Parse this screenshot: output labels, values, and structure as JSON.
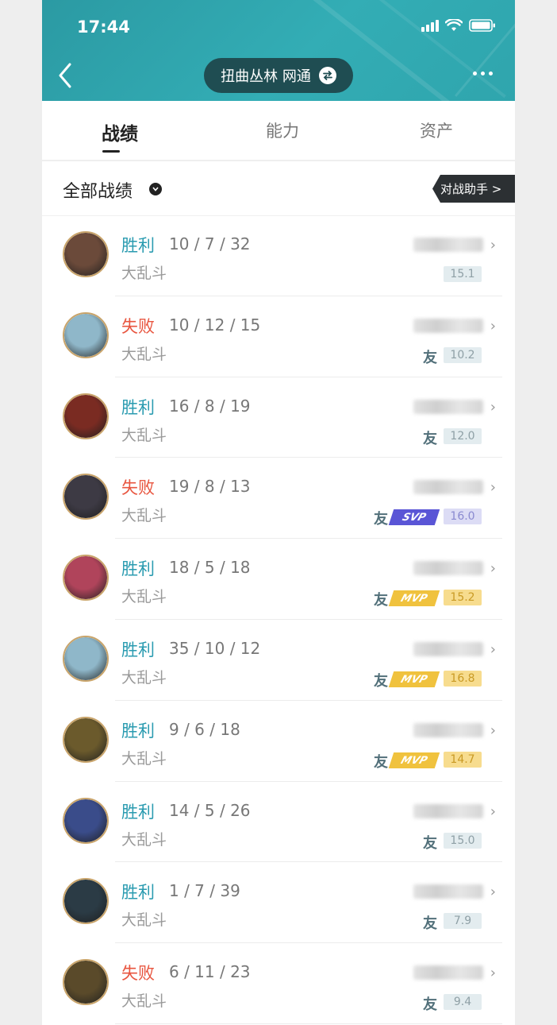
{
  "status_bar": {
    "time": "17:44"
  },
  "header": {
    "server": "扭曲丛林 网通"
  },
  "tabs": [
    {
      "label": "战绩",
      "active": true
    },
    {
      "label": "能力",
      "active": false
    },
    {
      "label": "资产",
      "active": false
    }
  ],
  "filter": {
    "label": "全部战绩",
    "assistant": "对战助手 >"
  },
  "matches": [
    {
      "result": "胜利",
      "outcome": "win",
      "kda": "10 / 7 / 32",
      "mode": "大乱斗",
      "friend": false,
      "medal": "",
      "score": "15.1",
      "score_type": "normal",
      "avatar_color": "#6b4a3a"
    },
    {
      "result": "失败",
      "outcome": "lose",
      "kda": "10 / 12 / 15",
      "mode": "大乱斗",
      "friend": true,
      "medal": "",
      "score": "10.2",
      "score_type": "normal",
      "avatar_color": "#8fb7c9"
    },
    {
      "result": "胜利",
      "outcome": "win",
      "kda": "16 / 8 / 19",
      "mode": "大乱斗",
      "friend": true,
      "medal": "",
      "score": "12.0",
      "score_type": "normal",
      "avatar_color": "#7a2b22"
    },
    {
      "result": "失败",
      "outcome": "lose",
      "kda": "19 / 8 / 13",
      "mode": "大乱斗",
      "friend": true,
      "medal": "SVP",
      "score": "16.0",
      "score_type": "svp",
      "avatar_color": "#3d3a44"
    },
    {
      "result": "胜利",
      "outcome": "win",
      "kda": "18 / 5 / 18",
      "mode": "大乱斗",
      "friend": true,
      "medal": "MVP",
      "score": "15.2",
      "score_type": "mvp",
      "avatar_color": "#b0445b"
    },
    {
      "result": "胜利",
      "outcome": "win",
      "kda": "35 / 10 / 12",
      "mode": "大乱斗",
      "friend": true,
      "medal": "MVP",
      "score": "16.8",
      "score_type": "mvp",
      "avatar_color": "#8fb7c9"
    },
    {
      "result": "胜利",
      "outcome": "win",
      "kda": "9 / 6 / 18",
      "mode": "大乱斗",
      "friend": true,
      "medal": "MVP",
      "score": "14.7",
      "score_type": "mvp",
      "avatar_color": "#6b5a2c"
    },
    {
      "result": "胜利",
      "outcome": "win",
      "kda": "14 / 5 / 26",
      "mode": "大乱斗",
      "friend": true,
      "medal": "",
      "score": "15.0",
      "score_type": "normal",
      "avatar_color": "#3a4c8a"
    },
    {
      "result": "胜利",
      "outcome": "win",
      "kda": "1 / 7 / 39",
      "mode": "大乱斗",
      "friend": true,
      "medal": "",
      "score": "7.9",
      "score_type": "normal",
      "avatar_color": "#2b3b45"
    },
    {
      "result": "失败",
      "outcome": "lose",
      "kda": "6 / 11 / 23",
      "mode": "大乱斗",
      "friend": true,
      "medal": "",
      "score": "9.4",
      "score_type": "normal",
      "avatar_color": "#5a4a2a"
    }
  ],
  "labels": {
    "friend": "友"
  }
}
